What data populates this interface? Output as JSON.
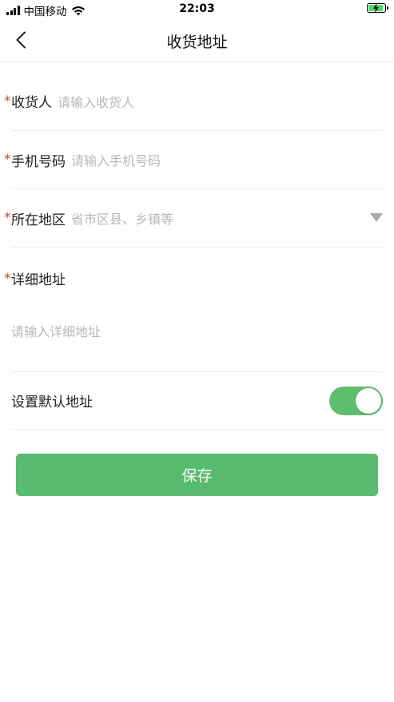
{
  "status_bar": {
    "carrier": "中国移动",
    "time": "22:03"
  },
  "nav": {
    "title": "收货地址"
  },
  "form": {
    "required_mark": "*",
    "receiver": {
      "label": "收货人",
      "placeholder": "请输入收货人"
    },
    "phone": {
      "label": "手机号码",
      "placeholder": "请输入手机号码"
    },
    "region": {
      "label": "所在地区",
      "placeholder": "省市区县、乡镇等"
    },
    "detail": {
      "label": "详细地址",
      "placeholder": "请输入详细地址"
    },
    "default_address": {
      "label": "设置默认地址",
      "enabled": true
    }
  },
  "actions": {
    "save_label": "保存"
  },
  "colors": {
    "accent": "#58bb6e",
    "required": "#e23b3b",
    "placeholder": "#b7b7bd"
  }
}
